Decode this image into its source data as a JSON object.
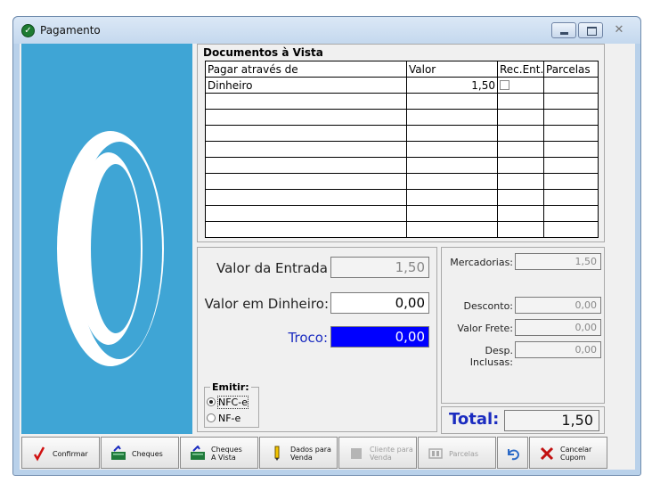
{
  "window": {
    "title": "Pagamento",
    "close_glyph": "✕"
  },
  "documents": {
    "title": "Documentos à Vista",
    "columns": [
      "Pagar através de",
      "Valor",
      "Rec.Ent.",
      "Parcelas"
    ],
    "rows": [
      {
        "metodo": "Dinheiro",
        "valor": "1,50",
        "rec_ent": false,
        "parcelas": ""
      }
    ]
  },
  "entry": {
    "valor_entrada_label": "Valor da Entrada",
    "valor_entrada": "1,50",
    "valor_dinheiro_label": "Valor em Dinheiro:",
    "valor_dinheiro": "0,00",
    "troco_label": "Troco:",
    "troco": "0,00"
  },
  "emitir": {
    "title": "Emitir:",
    "options": [
      "NFC-e",
      "NF-e"
    ],
    "selected": "NFC-e"
  },
  "summary": {
    "mercadorias_label": "Mercadorias:",
    "mercadorias": "1,50",
    "desconto_label": "Desconto:",
    "desconto": "0,00",
    "frete_label": "Valor Frete:",
    "frete": "0,00",
    "despesas_label": "Desp. Inclusas:",
    "despesas": "0,00",
    "total_label": "Total:",
    "total": "1,50"
  },
  "toolbar": {
    "confirmar": "Confirmar",
    "cheques": "Cheques",
    "cheques_vista_1": "Cheques",
    "cheques_vista_2": "A Vista",
    "dados_venda_1": "Dados para",
    "dados_venda_2": "Venda",
    "cliente_venda_1": "Cliente para",
    "cliente_venda_2": "Venda",
    "parcelas": "Parcelas",
    "cancelar_1": "Cancelar",
    "cancelar_2": "Cupom"
  },
  "colors": {
    "logo_bg": "#3fa5d5",
    "troco_bg": "#0000ff",
    "label_blue": "#1b2cc0"
  }
}
